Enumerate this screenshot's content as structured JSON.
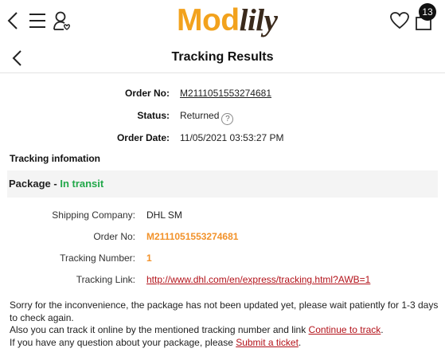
{
  "header": {
    "logo_part1": "Mod",
    "logo_part2": "lily",
    "cart_count": "13",
    "icons": [
      "back-arrow-icon",
      "menu-icon",
      "user-icon",
      "heart-icon",
      "shopping-bag-icon"
    ]
  },
  "page": {
    "title": "Tracking Results"
  },
  "summary": {
    "order_no_label": "Order No:",
    "order_no_value": "M2111051553274681",
    "status_label": "Status:",
    "status_value": "Returned",
    "help_glyph": "?",
    "order_date_label": "Order Date:",
    "order_date_value": "11/05/2021 03:53:27 PM"
  },
  "tracking": {
    "section_title": "Tracking infomation",
    "package_label": "Package",
    "package_sep": " - ",
    "package_status": "In transit",
    "shipping_company_label": "Shipping Company:",
    "shipping_company_value": "DHL SM",
    "order_no_label": "Order No:",
    "order_no_value": "M2111051553274681",
    "tracking_number_label": "Tracking Number:",
    "tracking_number_value": "1",
    "tracking_link_label": "Tracking Link:",
    "tracking_link_value": "http://www.dhl.com/en/express/tracking.html?AWB=1"
  },
  "note": {
    "line1": "Sorry for the inconvenience, the package has not been updated yet, please wait patiently for 1-3 days to check again.",
    "line2_prefix": "Also you can track it online by the mentioned tracking number and link ",
    "line2_link": "Continue to track",
    "line2_suffix": ".",
    "line3_prefix": "If you have any question about your package, please ",
    "line3_link": "Submit a ticket",
    "line3_suffix": "."
  },
  "colors": {
    "brand_orange": "#f2a21d",
    "status_green": "#22a84a",
    "link_red": "#b3121a",
    "value_orange": "#f2922a"
  }
}
